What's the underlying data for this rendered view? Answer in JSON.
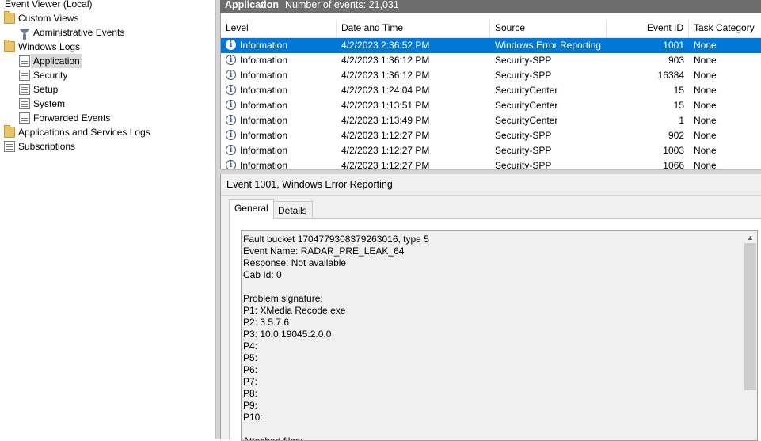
{
  "tree": {
    "items": [
      {
        "label": "Event Viewer (Local)",
        "icon": "event-viewer-icon",
        "indent": 0,
        "selected": false
      },
      {
        "label": "Custom Views",
        "icon": "folder-icon",
        "indent": 1,
        "selected": false
      },
      {
        "label": "Administrative Events",
        "icon": "filter-icon",
        "indent": 2,
        "selected": false
      },
      {
        "label": "Windows Logs",
        "icon": "folder-icon",
        "indent": 1,
        "selected": false
      },
      {
        "label": "Application",
        "icon": "log-icon",
        "indent": 2,
        "selected": true
      },
      {
        "label": "Security",
        "icon": "log-icon",
        "indent": 2,
        "selected": false
      },
      {
        "label": "Setup",
        "icon": "log-icon",
        "indent": 2,
        "selected": false
      },
      {
        "label": "System",
        "icon": "log-icon",
        "indent": 2,
        "selected": false
      },
      {
        "label": "Forwarded Events",
        "icon": "log-icon",
        "indent": 2,
        "selected": false
      },
      {
        "label": "Applications and Services Logs",
        "icon": "folder-icon",
        "indent": 1,
        "selected": false
      },
      {
        "label": "Subscriptions",
        "icon": "log-icon",
        "indent": 1,
        "selected": false
      }
    ]
  },
  "log_header": {
    "title": "Application",
    "count": "Number of events: 21,031"
  },
  "event_list": {
    "columns": [
      "Level",
      "Date and Time",
      "Source",
      "Event ID",
      "Task Category"
    ],
    "rows": [
      {
        "level": "Information",
        "datetime": "4/2/2023 2:36:52 PM",
        "source": "Windows Error Reporting",
        "event_id": "1001",
        "category": "None",
        "selected": true
      },
      {
        "level": "Information",
        "datetime": "4/2/2023 1:36:12 PM",
        "source": "Security-SPP",
        "event_id": "903",
        "category": "None",
        "selected": false
      },
      {
        "level": "Information",
        "datetime": "4/2/2023 1:36:12 PM",
        "source": "Security-SPP",
        "event_id": "16384",
        "category": "None",
        "selected": false
      },
      {
        "level": "Information",
        "datetime": "4/2/2023 1:24:04 PM",
        "source": "SecurityCenter",
        "event_id": "15",
        "category": "None",
        "selected": false
      },
      {
        "level": "Information",
        "datetime": "4/2/2023 1:13:51 PM",
        "source": "SecurityCenter",
        "event_id": "15",
        "category": "None",
        "selected": false
      },
      {
        "level": "Information",
        "datetime": "4/2/2023 1:13:49 PM",
        "source": "SecurityCenter",
        "event_id": "1",
        "category": "None",
        "selected": false
      },
      {
        "level": "Information",
        "datetime": "4/2/2023 1:12:27 PM",
        "source": "Security-SPP",
        "event_id": "902",
        "category": "None",
        "selected": false
      },
      {
        "level": "Information",
        "datetime": "4/2/2023 1:12:27 PM",
        "source": "Security-SPP",
        "event_id": "1003",
        "category": "None",
        "selected": false
      },
      {
        "level": "Information",
        "datetime": "4/2/2023 1:12:27 PM",
        "source": "Security-SPP",
        "event_id": "1066",
        "category": "None",
        "selected": false
      }
    ]
  },
  "detail": {
    "title": "Event 1001, Windows Error Reporting",
    "tabs": [
      "General",
      "Details"
    ],
    "active_tab": "General",
    "description_lines": [
      "Fault bucket 1704779308379263016, type 5",
      "Event Name: RADAR_PRE_LEAK_64",
      "Response: Not available",
      "Cab Id: 0",
      "",
      "Problem signature:",
      "P1: XMedia Recode.exe",
      "P2: 3.5.7.6",
      "P3: 10.0.19045.2.0.0",
      "P4:",
      "P5:",
      "P6:",
      "P7:",
      "P8:",
      "P9:",
      "P10:",
      "",
      "Attached files:"
    ]
  },
  "colors": {
    "selection": "#0078d7",
    "header_bar": "#6d6d6d",
    "info_icon": "#2b5aa5"
  }
}
